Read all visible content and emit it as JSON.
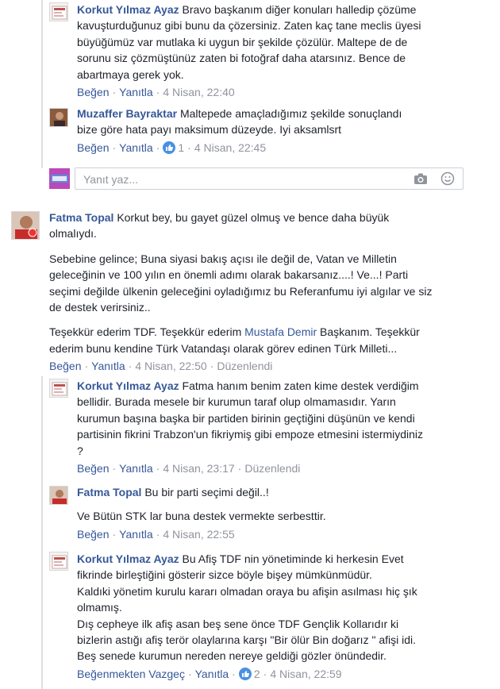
{
  "comments": [
    {
      "author": "Korkut Yılmaz Ayaz",
      "lines": [
        "Bravo başkanım diğer konuları halledip çözüme",
        "kavuşturduğunuz gibi bunu da çözersiniz. Zaten kaç tane meclis üyesi",
        "büyüğümüz var mutlaka ki uygun bir şekilde çözülür. Maltepe de de",
        "sorunu siz çözmüştünüz zaten bi fotoğraf daha atarsınız. Bence de",
        "abartmaya gerek yok."
      ],
      "like_label": "Beğen",
      "reply_label": "Yanıtla",
      "time": "4 Nisan, 22:40"
    },
    {
      "author": "Muzaffer Bayraktar",
      "lines": [
        "Maltepede amaçladığımız şekilde sonuçlandı",
        "bize göre hata payı maksimum düzeyde. Iyi aksamlsrt"
      ],
      "like_label": "Beğen",
      "reply_label": "Yanıtla",
      "reaction_count": "1",
      "time": "4 Nisan, 22:45"
    },
    {
      "author": "Fatma Topal",
      "lines": [
        "Korkut bey, bu gayet güzel olmuş ve bence daha büyük",
        "olmalıydı."
      ],
      "para2": [
        "Sebebine gelince; Buna siyasi bakış açısı ile değil de, Vatan ve Milletin",
        "geleceğinin ve 100 yılın en önemli adımı olarak bakarsanız....! Ve...! Parti",
        "seçimi değilde ülkenin geleceğini oyladığımız bu Referanfumu iyi algılar ve siz",
        "de destek verirsiniz.."
      ],
      "para3_start": "Teşekkür ederim TDF. Teşekkür ederim ",
      "para3_link": "Mustafa Demir",
      "para3_end": " Başkanım. Teşekkür",
      "para3_line2": "ederim bunu kendine Türk Vatandaşı olarak görev edinen Türk Milleti...",
      "like_label": "Beğen",
      "reply_label": "Yanıtla",
      "time": "4 Nisan, 22:50",
      "edited": "Düzenlendi"
    },
    {
      "author": "Korkut Yılmaz Ayaz",
      "lines": [
        "Fatma hanım benim zaten kime destek verdiğim",
        "bellidir. Burada mesele bir kurumun taraf olup olmamasıdır. Yarın",
        "kurumun başına başka bir partiden birinin geçtiğini düşünün ve kendi",
        "partisinin fikrini Trabzon'un fikriymiş gibi empoze etmesini istermiydiniz",
        "?"
      ],
      "like_label": "Beğen",
      "reply_label": "Yanıtla",
      "time": "4 Nisan, 23:17",
      "edited": "Düzenlendi"
    },
    {
      "author": "Fatma Topal",
      "lines": [
        "Bu bir parti seçimi değil..!"
      ],
      "para2": [
        "Ve Bütün STK lar buna destek vermekte serbesttir."
      ],
      "like_label": "Beğen",
      "reply_label": "Yanıtla",
      "time": "4 Nisan, 22:55"
    },
    {
      "author": "Korkut Yılmaz Ayaz",
      "lines": [
        "Bu Afiş TDF nin yönetiminde ki herkesin Evet",
        "fikrinde birleştiğini gösterir sizce böyle bişey mümkünmüdür.",
        "Kaldıki yönetim kurulu kararı olmadan oraya bu afişin asılması hiç şık",
        "olmamış.",
        "Dış cepheye ilk afiş asan beş sene önce TDF Gençlik Kollarıdır ki",
        "bizlerin astığı afiş terör olaylarına karşı \"Bir ölür Bin doğarız \" afişi idi.",
        "Beş senede kurumun nereden nereye geldiği gözler önündedir."
      ],
      "like_label": "Beğenmekten Vazgeç",
      "reply_label": "Yanıtla",
      "reaction_count": "2",
      "time": "4 Nisan, 22:59"
    }
  ],
  "reply_box": {
    "placeholder": "Yanıt yaz..."
  },
  "colors": {
    "link": "#365899",
    "meta": "#90949c",
    "text": "#1d2129",
    "like_badge": "#4a90e2"
  }
}
